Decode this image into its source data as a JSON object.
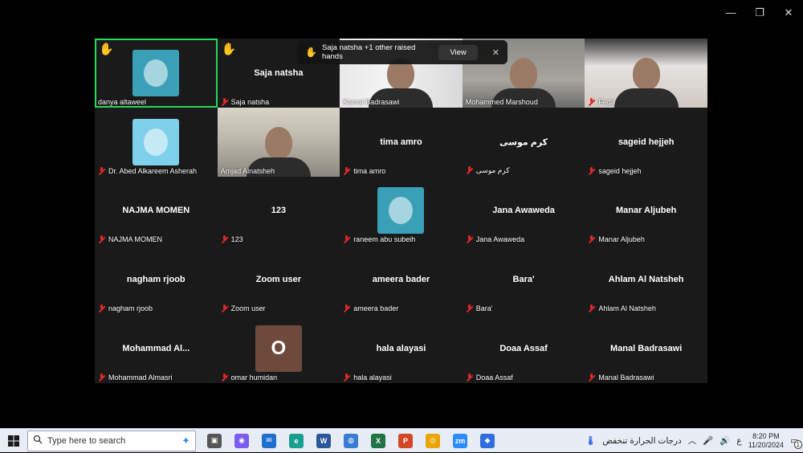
{
  "window_controls": {
    "minimize": "—",
    "maximize": "❐",
    "close": "✕"
  },
  "raised_hands_banner": {
    "text": "Saja natsha +1 other raised hands",
    "view_label": "View",
    "close_label": "✕"
  },
  "participants": [
    {
      "name": "danya altaweel",
      "display": "avatar",
      "active": true,
      "hand_raised": true,
      "muted": false
    },
    {
      "name": "Saja natsha",
      "display": "name",
      "hand_raised": true,
      "muted": true
    },
    {
      "name": "Kamal Badrasawi",
      "display": "video",
      "muted": false
    },
    {
      "name": "Mohammed Marshoud",
      "display": "video",
      "muted": false
    },
    {
      "name": "Feda",
      "display": "video",
      "muted": true
    },
    {
      "name": "Dr. Abed Alkareem Asherah",
      "display": "avatar",
      "muted": true
    },
    {
      "name": "Amjad Alnatsheh",
      "display": "video",
      "muted": false
    },
    {
      "name": "tima amro",
      "display": "name",
      "muted": true
    },
    {
      "name": "كرم موسى",
      "display": "name",
      "muted": true
    },
    {
      "name": "sageid hejjeh",
      "display": "name",
      "muted": true
    },
    {
      "name": "NAJMA MOMEN",
      "display": "name",
      "muted": true
    },
    {
      "name": "123",
      "display": "name",
      "muted": true
    },
    {
      "name": "raneem abu subeih",
      "display": "avatar",
      "muted": true
    },
    {
      "name": "Jana Awaweda",
      "display": "name",
      "muted": true
    },
    {
      "name": "Manar Aljubeh",
      "display": "name",
      "muted": true
    },
    {
      "name": "nagham rjoob",
      "display": "name",
      "muted": true
    },
    {
      "name": "Zoom user",
      "display": "name",
      "muted": true
    },
    {
      "name": "ameera bader",
      "display": "name",
      "muted": true
    },
    {
      "name": "Bara'",
      "display": "name",
      "muted": true
    },
    {
      "name": "Ahlam Al Natsheh",
      "display": "name",
      "muted": true
    },
    {
      "name": "Mohammad Almasri",
      "center_label": "Mohammad  Al...",
      "display": "name",
      "muted": true
    },
    {
      "name": "omar humidan",
      "display": "initial",
      "initial": "O",
      "muted": true
    },
    {
      "name": "hala alayasi",
      "display": "name",
      "muted": true
    },
    {
      "name": "Doaa Assaf",
      "display": "name",
      "muted": true
    },
    {
      "name": "Manal Badrasawi",
      "display": "name",
      "muted": true
    }
  ],
  "taskbar": {
    "search_placeholder": "Type here to search",
    "apps": [
      "task-view",
      "copilot",
      "mail",
      "edge",
      "word",
      "photos",
      "excel",
      "powerpoint",
      "chrome",
      "zoom",
      "app"
    ],
    "weather_text": "درجات الحرارة تنخفض",
    "lang": "ع",
    "time": "8:20 PM",
    "date": "11/20/2024",
    "notification_count": "1"
  }
}
